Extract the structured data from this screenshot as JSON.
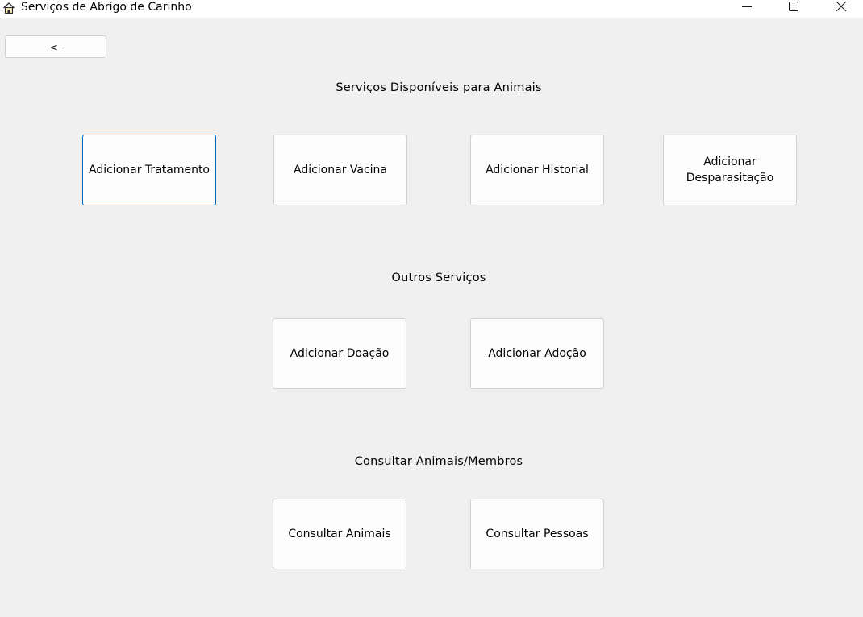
{
  "window": {
    "title": "Serviços de Abrigo de Carinho",
    "icon": "house-icon",
    "controls": [
      "minimize-icon",
      "maximize-icon",
      "close-icon"
    ]
  },
  "back_button": {
    "label": "<-"
  },
  "sections": {
    "animal_services": {
      "heading": "Serviços Disponíveis para Animais",
      "buttons": [
        {
          "label": "Adicionar Tratamento",
          "focused": true
        },
        {
          "label": "Adicionar Vacina"
        },
        {
          "label": "Adicionar Historial"
        },
        {
          "label": "Adicionar Desparasitação"
        }
      ]
    },
    "other_services": {
      "heading": "Outros Serviços",
      "buttons": [
        {
          "label": "Adicionar Doação"
        },
        {
          "label": "Adicionar Adoção"
        }
      ]
    },
    "consult": {
      "heading": "Consultar Animais/Membros",
      "buttons": [
        {
          "label": "Consultar Animais"
        },
        {
          "label": "Consultar Pessoas"
        }
      ]
    }
  },
  "colors": {
    "background": "#f0f0f0",
    "button_face": "#fdfdfd",
    "button_border": "#d0d0d0",
    "focus_border": "#0067c0"
  }
}
